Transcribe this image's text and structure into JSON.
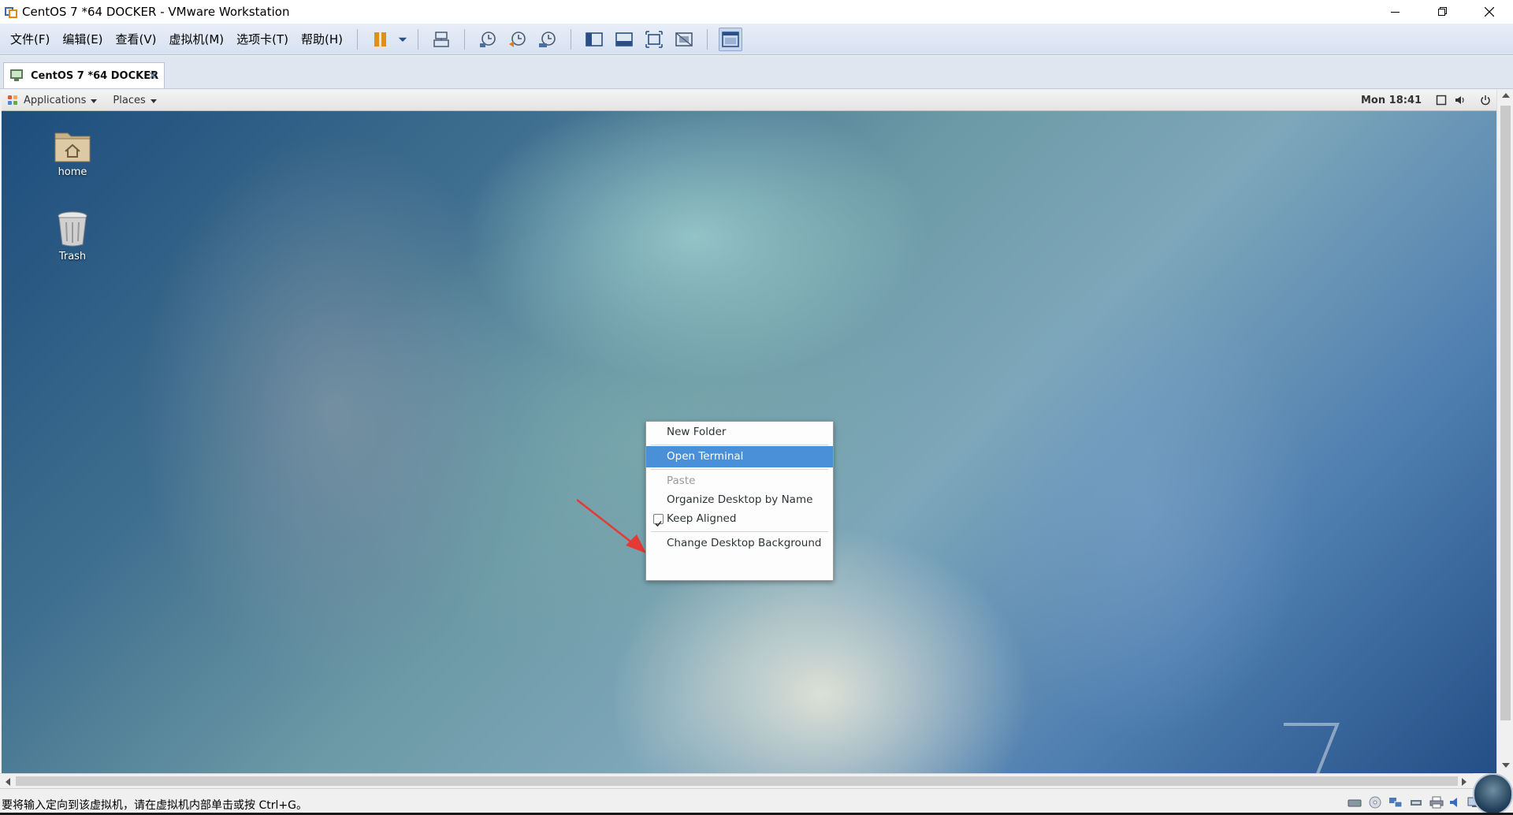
{
  "window": {
    "title": "CentOS 7 *64 DOCKER - VMware Workstation"
  },
  "menubar": {
    "items": [
      "文件(F)",
      "编辑(E)",
      "查看(V)",
      "虚拟机(M)",
      "选项卡(T)",
      "帮助(H)"
    ]
  },
  "toolbar": {
    "icons": [
      "pause-icon",
      "dropdown-icon",
      "send-ctrl-alt-del-icon",
      "snapshot-icon",
      "revert-snapshot-icon",
      "snapshot-manager-icon",
      "show-library-icon",
      "thumbnail-bar-icon",
      "full-screen-icon",
      "unity-icon",
      "console-view-icon"
    ]
  },
  "tab": {
    "label": "CentOS 7 *64 DOCKER",
    "close_glyph": "✕"
  },
  "gnome_panel": {
    "applications": "Applications",
    "places": "Places",
    "clock": "Mon 18:41"
  },
  "desktop": {
    "icons": [
      {
        "label": "home"
      },
      {
        "label": "Trash"
      }
    ],
    "watermark": "7"
  },
  "context_menu": {
    "items": [
      {
        "label": "New Folder",
        "state": "normal"
      },
      {
        "label": "Open Terminal",
        "state": "highlighted"
      },
      {
        "label": "Paste",
        "state": "disabled"
      },
      {
        "label": "Organize Desktop by Name",
        "state": "normal"
      },
      {
        "label": "Keep Aligned",
        "state": "checked"
      },
      {
        "label": "Change Desktop Background",
        "state": "normal"
      }
    ]
  },
  "statusbar": {
    "text": "要将输入定向到该虚拟机，请在虚拟机内部单击或按 Ctrl+G。"
  },
  "colors": {
    "highlight": "#4a90d9",
    "arrow": "#e53935",
    "pause": "#e0901a"
  }
}
